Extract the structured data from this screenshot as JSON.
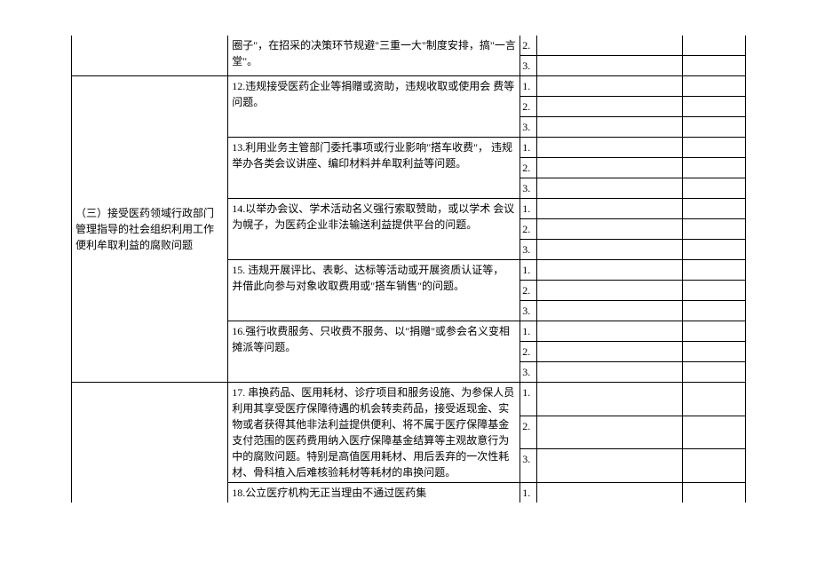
{
  "section_prev": {
    "item11_tail": "圈子\"，在招采的决策环节规避\"三重一大\"制度安排，搞\"一言堂\"。",
    "nums": [
      "2.",
      "3."
    ]
  },
  "section3": {
    "title": "（三）接受医药领域行政部门管理指导的社会组织利用工作便利牟取利益的腐败问题",
    "items": [
      {
        "text": "12.违规接受医药企业等捐赠或资助，违规收取或使用会\n费等问题。",
        "nums": [
          "1.",
          "2.",
          "3."
        ]
      },
      {
        "text": "13.利用业务主管部门委托事项或行业影响\"搭车收费\"，\n违规举办各类会议讲座、编印材料并牟取利益等问题。",
        "nums": [
          "1.",
          "2.",
          "3."
        ]
      },
      {
        "text": "14.以举办会议、学术活动名义强行索取赞助，或以学术\n会议为幌子，为医药企业非法输送利益提供平台的问题。",
        "nums": [
          "1.",
          "2.",
          "3."
        ]
      },
      {
        "text": "15. 违规开展评比、表彰、达标等活动或开展资质认证等，\n并借此向参与对象收取费用或\"搭车销售\"的问题。",
        "nums": [
          "1.",
          "2.",
          "3."
        ]
      },
      {
        "text": "16.强行收费服务、只收费不服务、以\"捐赠\"或参会名义变相摊派等问题。",
        "nums": [
          "1.",
          "2.",
          "3."
        ]
      }
    ]
  },
  "section4": {
    "items": [
      {
        "text": "17. 串换药品、医用耗材、诊疗项目和服务设施、为参保人员利用其享受医疗保障待遇的机会转卖药品，接受返现金、实物或者获得其他非法利益提供便利、将不属于医疗保障基金支付范围的医药费用纳入医疗保障基金结算等主观故意行为中的腐败问题。特别是高值医用耗材、用后丢弃的一次性耗材、骨科植入后难核验耗材等耗材的串换问题。",
        "nums": [
          "1.",
          "2.",
          "3."
        ]
      },
      {
        "text": "18.公立医疗机构无正当理由不通过医药集",
        "nums": [
          "1."
        ]
      }
    ]
  }
}
